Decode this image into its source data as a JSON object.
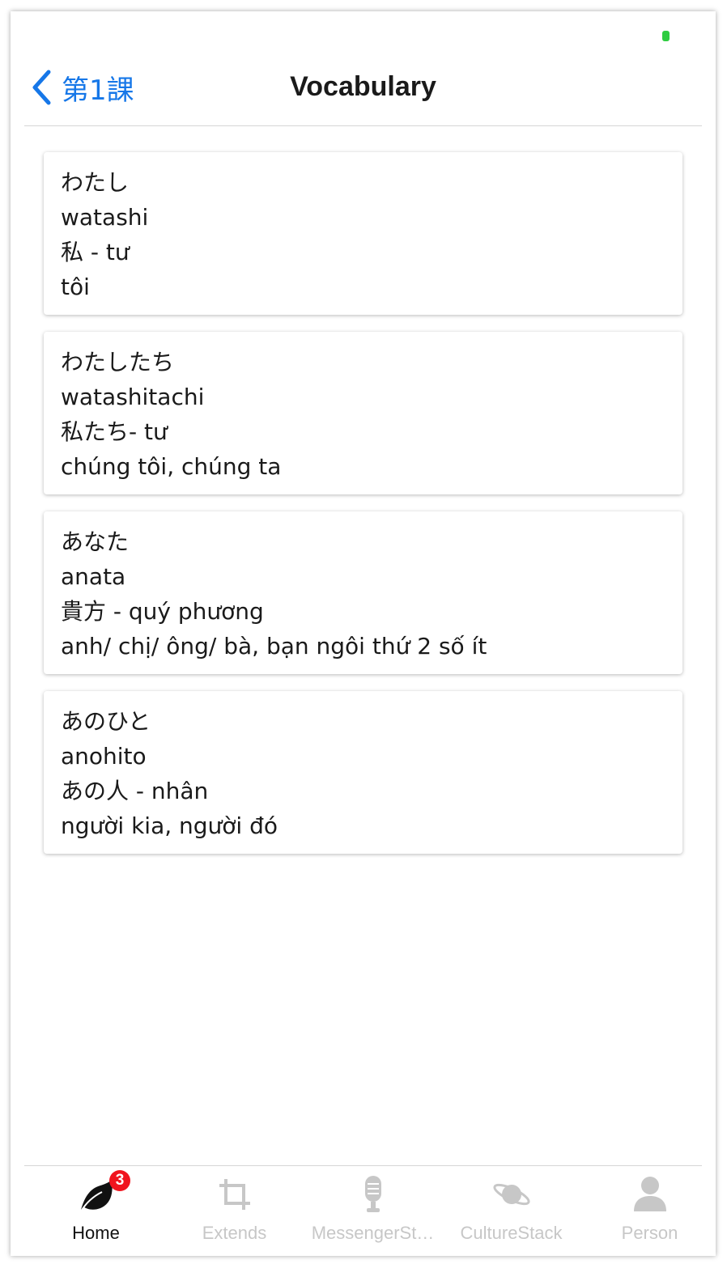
{
  "nav": {
    "back_label": "第1課",
    "title": "Vocabulary"
  },
  "colors": {
    "accent": "#1677e8",
    "status_indicator": "#2ecc40",
    "badge": "#f0141e",
    "tab_inactive": "#c7c7c7"
  },
  "vocabulary": [
    {
      "kana": "わたし",
      "romaji": "watashi",
      "kanji": "私 - tư",
      "meaning": "tôi"
    },
    {
      "kana": "わたしたち",
      "romaji": "watashitachi",
      "kanji": "私たち- tư",
      "meaning": "chúng tôi, chúng ta"
    },
    {
      "kana": "あなた",
      "romaji": "anata",
      "kanji": "貴方 - quý phương",
      "meaning": "anh/ chị/ ông/ bà, bạn ngôi thứ 2 số ít"
    },
    {
      "kana": "あのひと",
      "romaji": "anohito",
      "kanji": "あの人 - nhân",
      "meaning": "người kia, người đó"
    }
  ],
  "tabbar": {
    "tabs": [
      {
        "label": "Home",
        "icon": "leaf-icon",
        "badge": "3",
        "active": true
      },
      {
        "label": "Extends",
        "icon": "crop-icon",
        "active": false
      },
      {
        "label": "MessengerSt…",
        "icon": "microphone-icon",
        "active": false
      },
      {
        "label": "CultureStack",
        "icon": "planet-icon",
        "active": false
      },
      {
        "label": "Person",
        "icon": "person-icon",
        "active": false
      }
    ]
  }
}
